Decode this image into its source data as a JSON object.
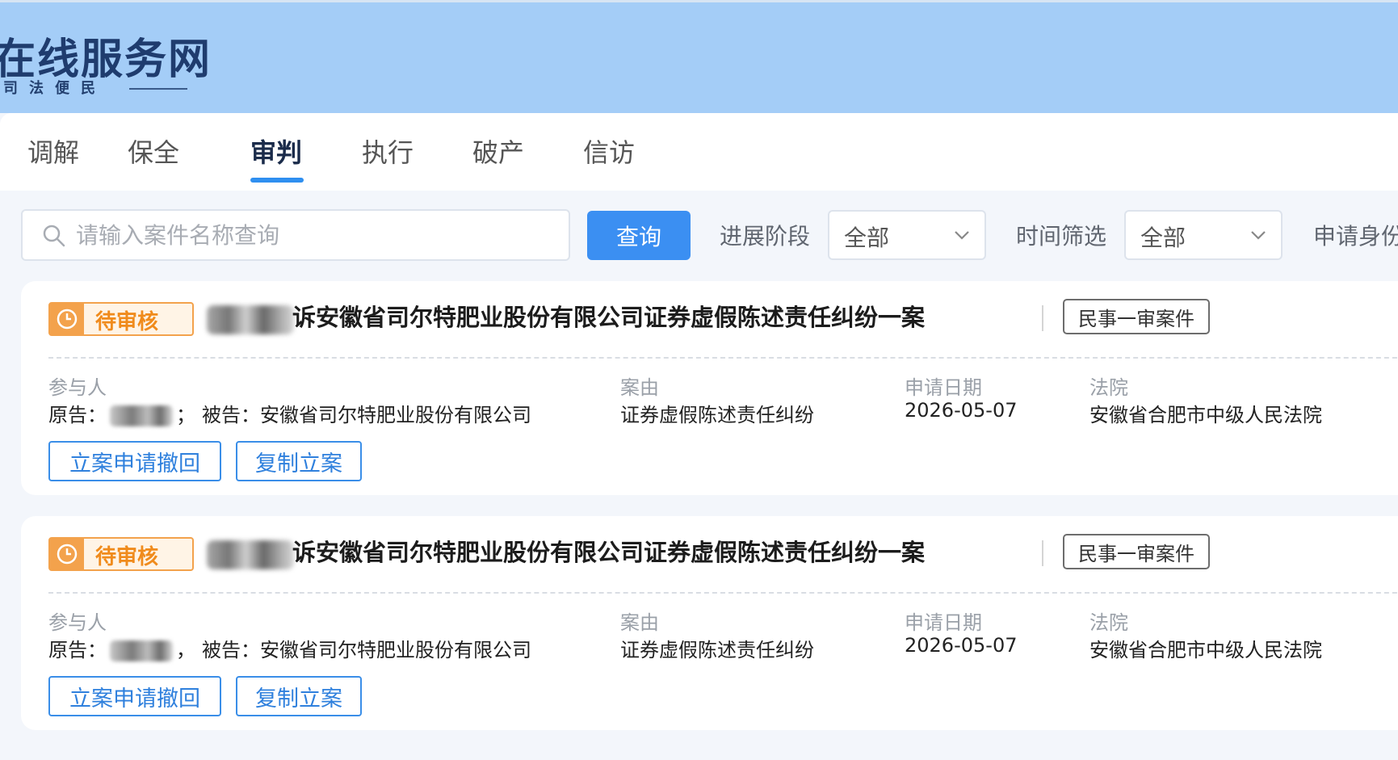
{
  "header": {
    "title": "在线服务网",
    "subtitle": "司法便民"
  },
  "nav": {
    "tabs": [
      "调解",
      "保全",
      "审判",
      "执行",
      "破产",
      "信访"
    ],
    "active": "审判"
  },
  "filters": {
    "search_placeholder": "请输入案件名称查询",
    "query_button": "查询",
    "progress_label": "进展阶段",
    "progress_value": "全部",
    "time_label": "时间筛选",
    "time_value": "全部",
    "identity_label": "申请身份"
  },
  "labels": {
    "participants": "参与人",
    "cause": "案由",
    "apply_date": "申请日期",
    "court": "法院",
    "plaintiff": "原告：",
    "defendant": "被告："
  },
  "cases": [
    {
      "status": "待审核",
      "title": "诉安徽省司尔特肥业股份有限公司证券虚假陈述责任纠纷一案",
      "type": "民事一审案件",
      "defendant": "安徽省司尔特肥业股份有限公司",
      "separator": "；",
      "cause": "证券虚假陈述责任纠纷",
      "date": "2026-05-07",
      "court": "安徽省合肥市中级人民法院",
      "withdraw_button": "立案申请撤回",
      "copy_button": "复制立案"
    },
    {
      "status": "待审核",
      "title": "诉安徽省司尔特肥业股份有限公司证券虚假陈述责任纠纷一案",
      "type": "民事一审案件",
      "defendant": "安徽省司尔特肥业股份有限公司",
      "separator": "，",
      "cause": "证券虚假陈述责任纠纷",
      "date": "2026-05-07",
      "court": "安徽省合肥市中级人民法院",
      "withdraw_button": "立案申请撤回",
      "copy_button": "复制立案"
    }
  ],
  "colors": {
    "header_bg": "#a4cdf7",
    "accent": "#3b8ff2",
    "pending": "#f3a24c"
  }
}
